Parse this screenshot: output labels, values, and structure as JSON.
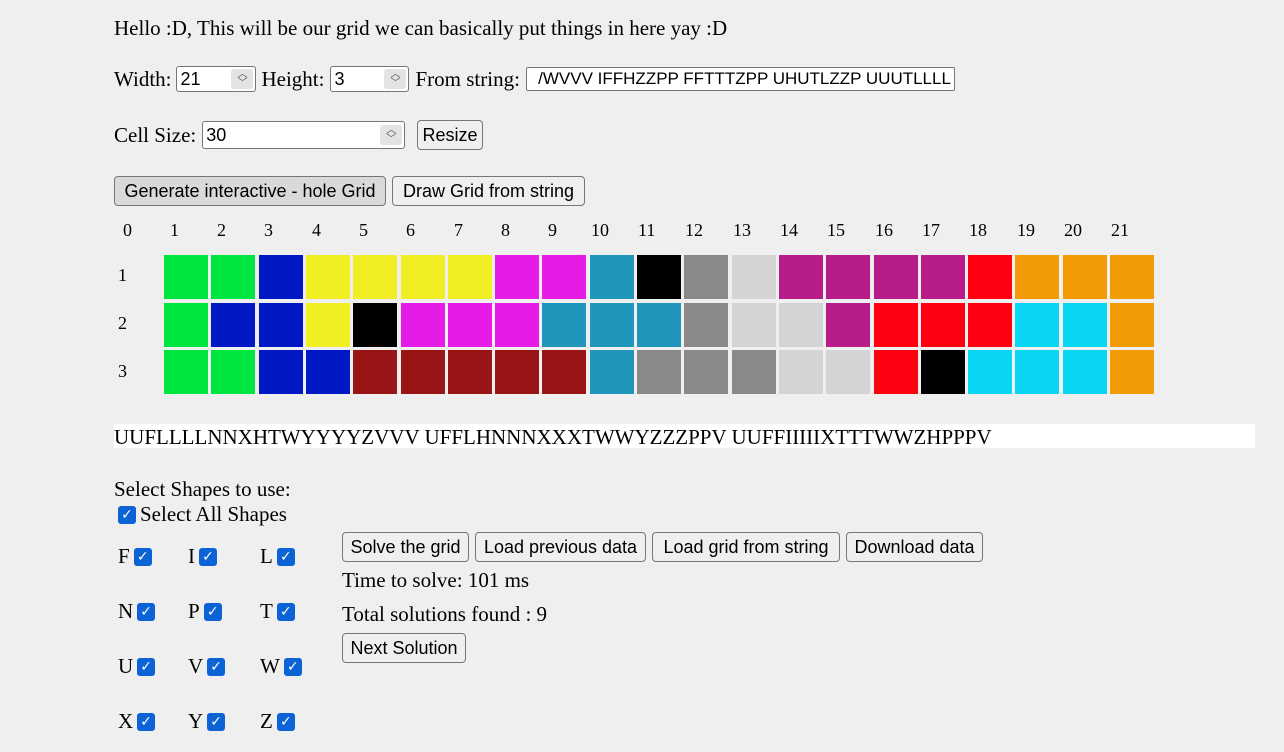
{
  "intro": "Hello :D, This will be our grid we can basically put things in here yay :D",
  "controls": {
    "width_label": "Width:",
    "width_value": "21",
    "height_label": "Height:",
    "height_value": "3",
    "from_string_label": "From string:",
    "from_string_value": "/WVVV IFFHZZPP FFTTTZPP UHUTLZZP UUUTLLLL",
    "cell_size_label": "Cell Size:",
    "cell_size_value": "30",
    "resize_label": "Resize",
    "generate_label": "Generate interactive - hole Grid",
    "draw_label": "Draw Grid from string"
  },
  "grid": {
    "column_headers": [
      "0",
      "1",
      "2",
      "3",
      "4",
      "5",
      "6",
      "7",
      "8",
      "9",
      "10",
      "11",
      "12",
      "13",
      "14",
      "15",
      "16",
      "17",
      "18",
      "19",
      "20",
      "21"
    ],
    "row_headers": [
      "1",
      "2",
      "3"
    ],
    "colors": {
      "green": "#00e640",
      "blue": "#0019c4",
      "yellow": "#f2ee26",
      "magenta": "#e61ce6",
      "teal": "#2196bc",
      "black": "#000000",
      "gray": "#898989",
      "lightgray": "#d4d4d4",
      "plum": "#b81c88",
      "red": "#ff0010",
      "orange": "#f29b05",
      "cyan": "#08d6f2",
      "darkred": "#991414"
    },
    "rows": [
      [
        "green",
        "green",
        "blue",
        "yellow",
        "yellow",
        "yellow",
        "yellow",
        "magenta",
        "magenta",
        "teal",
        "black",
        "gray",
        "lightgray",
        "plum",
        "plum",
        "plum",
        "plum",
        "red",
        "orange",
        "orange",
        "orange"
      ],
      [
        "green",
        "blue",
        "blue",
        "yellow",
        "black",
        "magenta",
        "magenta",
        "magenta",
        "teal",
        "teal",
        "teal",
        "gray",
        "lightgray",
        "lightgray",
        "plum",
        "red",
        "red",
        "red",
        "cyan",
        "cyan",
        "orange"
      ],
      [
        "green",
        "green",
        "blue",
        "blue",
        "darkred",
        "darkred",
        "darkred",
        "darkred",
        "darkred",
        "teal",
        "gray",
        "gray",
        "gray",
        "lightgray",
        "lightgray",
        "red",
        "black",
        "cyan",
        "cyan",
        "cyan",
        "orange"
      ]
    ]
  },
  "solution_string": "UUFLLLLNNXHTWYYYYZVVV UFFLHNNNXXXTWWYZZZPPV UUFFIIIIIXTTTWWZHPPPV",
  "shapes": {
    "title": "Select Shapes to use:",
    "select_all_label": "Select All Shapes",
    "items": [
      "F",
      "I",
      "L",
      "N",
      "P",
      "T",
      "U",
      "V",
      "W",
      "X",
      "Y",
      "Z"
    ]
  },
  "actions": {
    "solve_label": "Solve the grid",
    "load_prev_label": "Load previous data",
    "load_string_label": "Load grid from string",
    "download_label": "Download data",
    "next_label": "Next Solution"
  },
  "status": {
    "time_text": "Time to solve: 101 ms",
    "solutions_text": "Total solutions found : 9"
  },
  "icons": {
    "check": "checkbox-checked-icon",
    "spinner": "spinner-arrows-icon"
  }
}
